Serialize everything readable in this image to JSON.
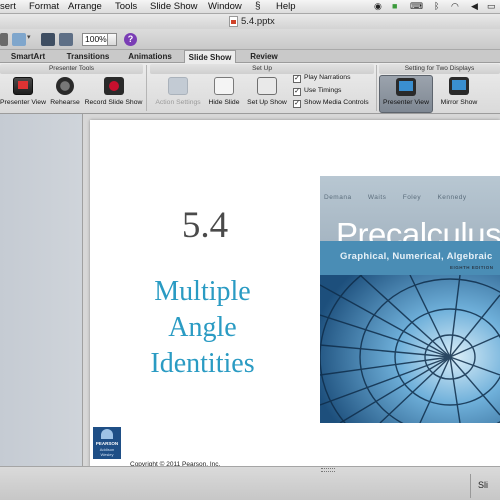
{
  "menubar": {
    "items": [
      "sert",
      "Format",
      "Arrange",
      "Tools",
      "Slide Show",
      "Window",
      "Help"
    ],
    "script_icon": "script-icon",
    "status_icons": [
      "record-icon",
      "evernote-icon",
      "keyboard-icon",
      "bluetooth-icon",
      "wifi-icon",
      "sound-icon",
      "battery-icon"
    ]
  },
  "window": {
    "title": "5.4.pptx"
  },
  "toolbar": {
    "zoom": "100%",
    "help_label": "?"
  },
  "ribbon": {
    "tabs": [
      "SmartArt",
      "Transitions",
      "Animations",
      "Slide Show",
      "Review"
    ],
    "active_tab": "Slide Show",
    "groups": {
      "presenter_tools": {
        "title": "Presenter Tools",
        "buttons": [
          "Presenter View",
          "Rehearse",
          "Record Slide Show"
        ]
      },
      "set_up": {
        "title": "Set Up",
        "buttons": [
          "Action Settings",
          "Hide Slide",
          "Set Up Show"
        ],
        "checkboxes": [
          {
            "label": "Play Narrations",
            "checked": true
          },
          {
            "label": "Use Timings",
            "checked": true
          },
          {
            "label": "Show Media Controls",
            "checked": true
          }
        ]
      },
      "two_displays": {
        "title": "Setting for Two Displays",
        "buttons": [
          "Presenter View",
          "Mirror Show"
        ]
      }
    },
    "colors": {
      "record": "#c8102e",
      "display_blue": "#3a8fd0"
    }
  },
  "slide": {
    "number": "5.4",
    "title_lines": [
      "Multiple",
      "Angle",
      "Identities"
    ],
    "title_color": "#2a9bc3",
    "copyright": "Copyright © 2011 Pearson, Inc.",
    "logo": {
      "name": "PEARSON",
      "sub": [
        "Addison",
        "Wesley"
      ]
    },
    "cover": {
      "authors": [
        "Demana",
        "Waits",
        "Foley",
        "Kennedy"
      ],
      "title": "Precalculus",
      "subtitle": "Graphical, Numerical, Algebraic",
      "edition": "EIGHTH EDITION"
    }
  },
  "statusbar": {
    "view_label": "Sli"
  }
}
